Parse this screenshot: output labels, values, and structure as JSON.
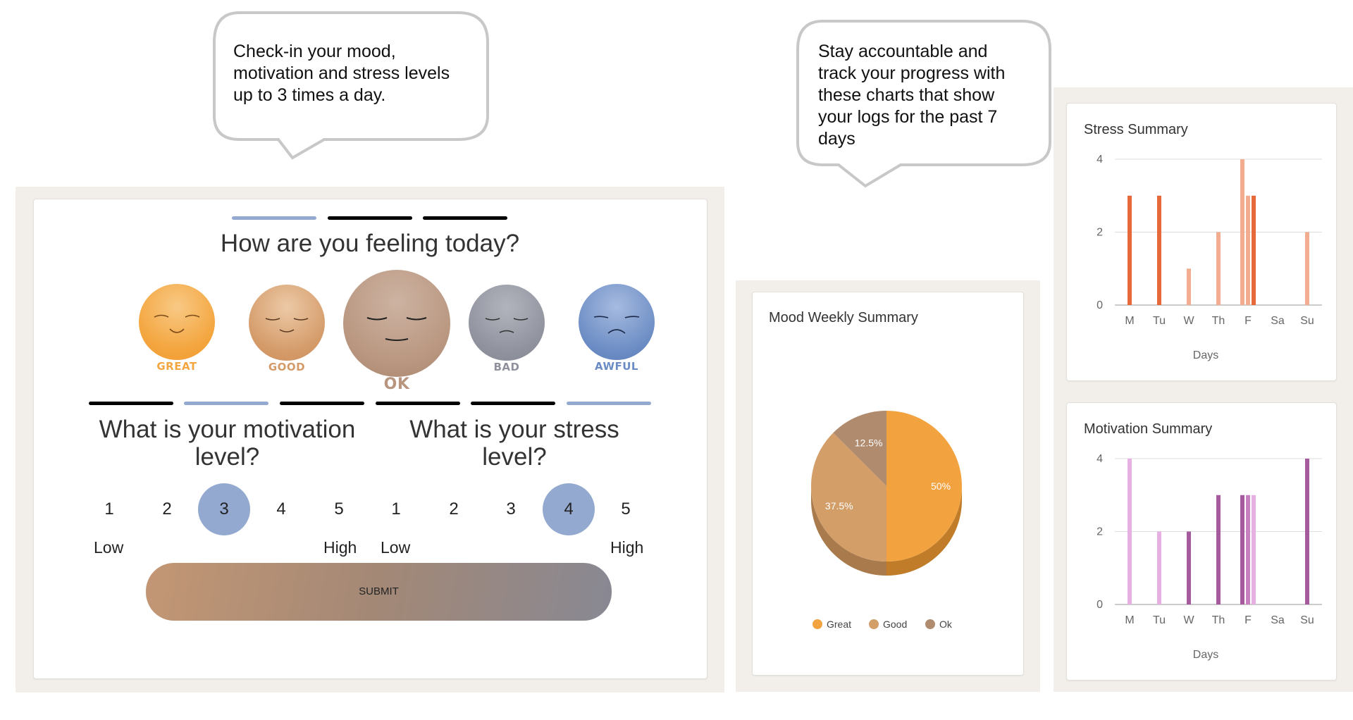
{
  "bubbles": {
    "left": {
      "lines": [
        "Check-in your mood,",
        "motivation and stress levels",
        "up to 3 times a day."
      ]
    },
    "right": {
      "lines": [
        "Stay accountable and",
        "track your progress with",
        "these charts that show",
        "your logs for the past 7",
        "days"
      ]
    }
  },
  "checkin": {
    "mood_question": "How are you feeling today?",
    "moods": [
      {
        "label": "GREAT",
        "color": "#f4a640"
      },
      {
        "label": "GOOD",
        "color": "#d49a68"
      },
      {
        "label": "OK",
        "color": "#b8957e"
      },
      {
        "label": "BAD",
        "color": "#8f919d"
      },
      {
        "label": "AWFUL",
        "color": "#6b8cc4"
      }
    ],
    "selected_mood": "OK",
    "motivation_question": "What is your motivation level?",
    "stress_question": "What is your stress level?",
    "scale": [
      "1",
      "2",
      "3",
      "4",
      "5"
    ],
    "low_label": "Low",
    "high_label": "High",
    "motivation_selected": "3",
    "stress_selected": "4",
    "submit_label": "SUBMIT",
    "colors": {
      "selected": "#94a9d0",
      "progress_active": "#94a9d0",
      "progress_inactive": "#000000"
    }
  },
  "mood_chart": {
    "title": "Mood Weekly Summary"
  },
  "stress_chart": {
    "title": "Stress Summary"
  },
  "motivation_chart": {
    "title": "Motivation Summary"
  },
  "chart_data": [
    {
      "type": "pie",
      "title": "Mood Weekly Summary",
      "categories": [
        "Great",
        "Good",
        "Ok"
      ],
      "values": [
        50,
        37.5,
        12.5
      ],
      "labels": [
        "50%",
        "37.5%",
        "12.5%"
      ],
      "colors": [
        "#f2a340",
        "#d39e68",
        "#b08b6e"
      ],
      "legend": "bottom"
    },
    {
      "type": "bar",
      "title": "Stress Summary",
      "categories": [
        "M",
        "Tu",
        "W",
        "Th",
        "F",
        "Sa",
        "Su"
      ],
      "xlabel": "Days",
      "ylim": [
        0,
        4
      ],
      "yticks": [
        "0",
        "2",
        "4"
      ],
      "bars": [
        {
          "day": "M",
          "values": [
            3
          ]
        },
        {
          "day": "Tu",
          "values": [
            3
          ]
        },
        {
          "day": "W",
          "values": [
            1
          ]
        },
        {
          "day": "Th",
          "values": [
            2
          ]
        },
        {
          "day": "F",
          "values": [
            4,
            3,
            3
          ]
        },
        {
          "day": "Sa",
          "values": []
        },
        {
          "day": "Su",
          "values": [
            2
          ]
        }
      ],
      "colors": {
        "dark": "#e6683b",
        "light": "#f2ad91"
      },
      "shading": {
        "M": [
          "dark"
        ],
        "Tu": [
          "dark"
        ],
        "W": [
          "light"
        ],
        "Th": [
          "light"
        ],
        "F": [
          "light",
          "light",
          "dark"
        ],
        "Su": [
          "light"
        ]
      },
      "grid": true
    },
    {
      "type": "bar",
      "title": "Motivation Summary",
      "categories": [
        "M",
        "Tu",
        "W",
        "Th",
        "F",
        "Sa",
        "Su"
      ],
      "xlabel": "Days",
      "ylim": [
        0,
        4
      ],
      "yticks": [
        "0",
        "2",
        "4"
      ],
      "bars": [
        {
          "day": "M",
          "values": [
            4
          ]
        },
        {
          "day": "Tu",
          "values": [
            2
          ]
        },
        {
          "day": "W",
          "values": [
            2
          ]
        },
        {
          "day": "Th",
          "values": [
            3
          ]
        },
        {
          "day": "F",
          "values": [
            3,
            3,
            3
          ]
        },
        {
          "day": "Sa",
          "values": []
        },
        {
          "day": "Su",
          "values": [
            4
          ]
        }
      ],
      "colors": {
        "dark": "#a45a9c",
        "mid": "#c77fc0",
        "light": "#e6b0e2"
      },
      "shading": {
        "M": [
          "light"
        ],
        "Tu": [
          "light"
        ],
        "W": [
          "dark"
        ],
        "Th": [
          "dark"
        ],
        "F": [
          "dark",
          "mid",
          "light"
        ],
        "Su": [
          "dark"
        ]
      },
      "grid": true
    }
  ]
}
